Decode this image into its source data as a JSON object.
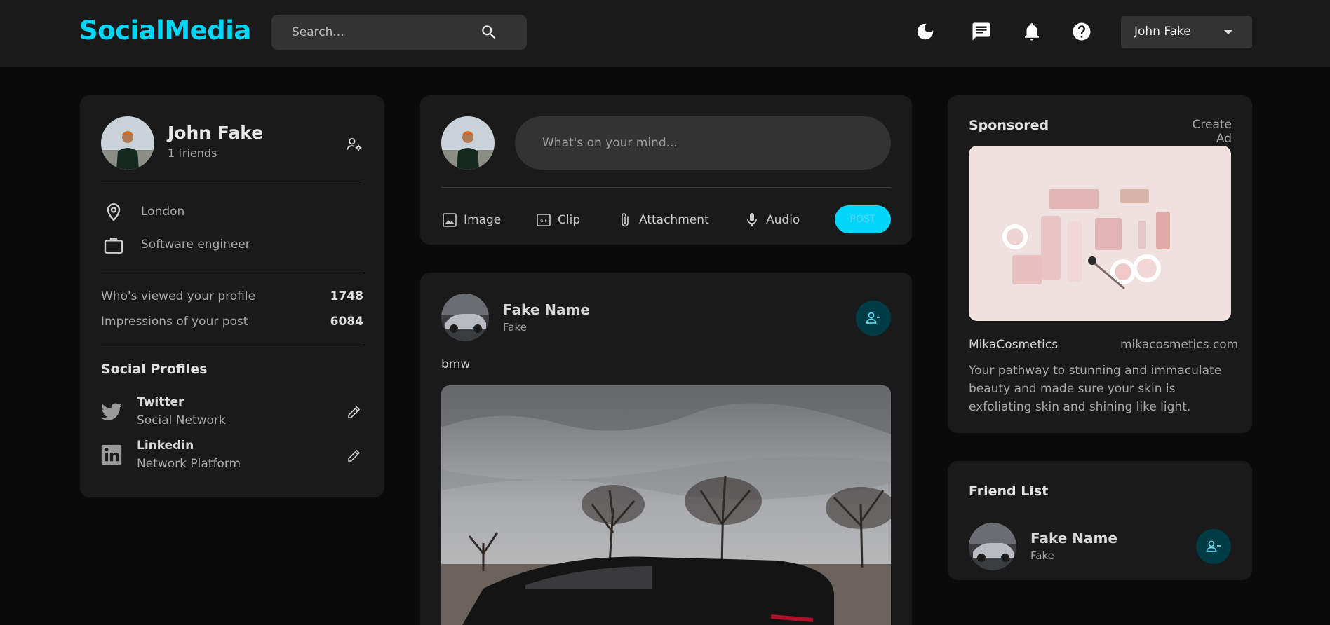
{
  "header": {
    "logo": "SocialMedia",
    "search_placeholder": "Search...",
    "icons": [
      "moon-icon",
      "message-icon",
      "bell-icon",
      "help-icon"
    ],
    "user_menu_label": "John Fake"
  },
  "profile": {
    "name": "John Fake",
    "friends": "1 friends",
    "location": "London",
    "occupation": "Software engineer",
    "stats": [
      {
        "label": "Who's viewed your profile",
        "value": "1748"
      },
      {
        "label": "Impressions of your post",
        "value": "6084"
      }
    ],
    "social_title": "Social Profiles",
    "socials": [
      {
        "name": "Twitter",
        "type": "Social Network",
        "icon": "twitter-icon"
      },
      {
        "name": "Linkedin",
        "type": "Network Platform",
        "icon": "linkedin-icon"
      }
    ]
  },
  "compose": {
    "placeholder": "What's on your mind...",
    "tools": [
      "Image",
      "Clip",
      "Attachment",
      "Audio"
    ],
    "post_label": "POST"
  },
  "feed": {
    "posts": [
      {
        "name": "Fake Name",
        "subtitle": "Fake",
        "description": "bmw"
      }
    ]
  },
  "sponsored": {
    "title": "Sponsored",
    "create_label": "Create Ad",
    "brand": "MikaCosmetics",
    "url": "mikacosmetics.com",
    "description": "Your pathway to stunning and immaculate beauty and made sure your skin is exfoliating skin and shining like light."
  },
  "friend_list": {
    "title": "Friend List",
    "friends": [
      {
        "name": "Fake Name",
        "subtitle": "Fake"
      }
    ]
  },
  "colors": {
    "accent": "#00d5fa",
    "background": "#0a0a0a",
    "card": "#1a1a1a",
    "friend_button_bg": "#003c46"
  }
}
